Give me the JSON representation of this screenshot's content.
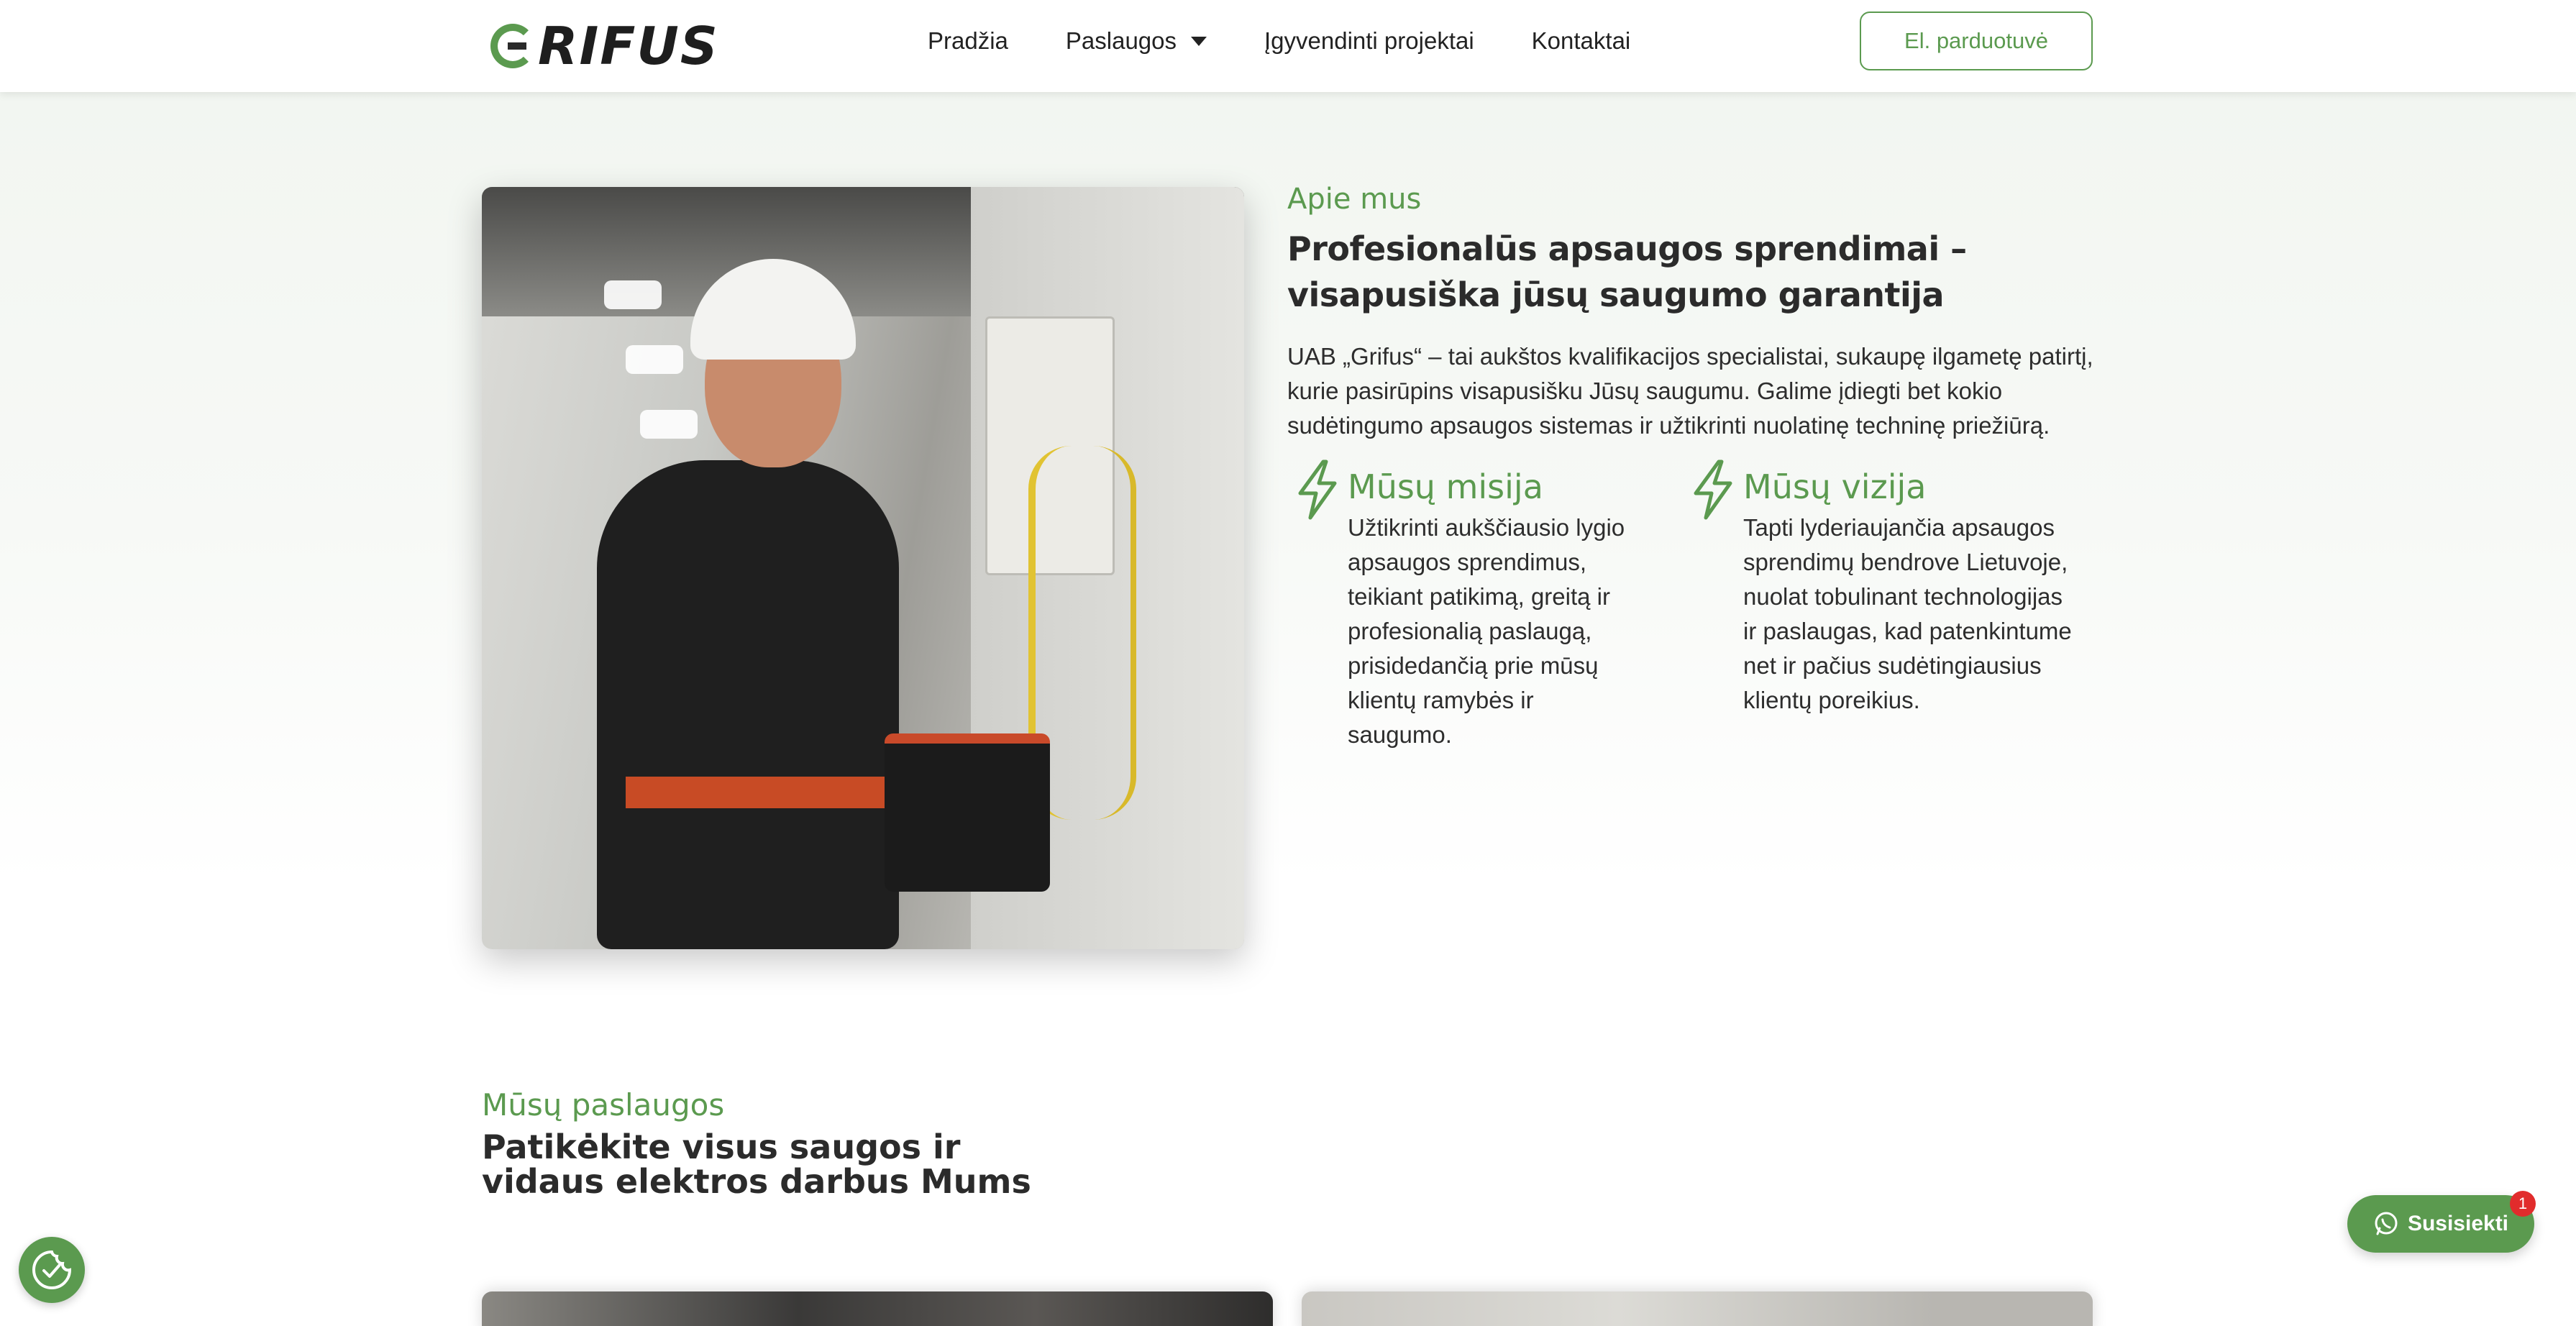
{
  "header": {
    "logo_text": "RIFUS",
    "nav": [
      {
        "label": "Pradžia"
      },
      {
        "label": "Paslaugos"
      },
      {
        "label": "Įgyvendinti projektai"
      },
      {
        "label": "Kontaktai"
      }
    ],
    "shop_button": "El. parduotuvė"
  },
  "about": {
    "eyebrow": "Apie mus",
    "title": "Profesionalūs apsaugos sprendimai – visapusiška jūsų saugumo garantija",
    "description": "UAB „Grifus“ – tai aukštos kvalifikacijos specialistai, sukaupę ilgametę patirtį, kurie pasirūpins visapusišku Jūsų saugumu. Galime įdiegti bet kokio sudėtingumo apsaugos sistemas ir užtikrinti nuolatinę techninę priežiūrą.",
    "mission": {
      "title": "Mūsų misija",
      "text": "Užtikrinti aukščiausio lygio apsaugos sprendimus, teikiant patikimą, greitą ir profesionalią paslaugą, prisidedančią prie mūsų klientų ramybės ir saugumo."
    },
    "vision": {
      "title": "Mūsų vizija",
      "text": "Tapti lyderiaujančia apsaugos sprendimų bendrove Lietuvoje, nuolat tobulinant technologijas ir paslaugas, kad patenkintume net ir pačius sudėtingiausius klientų poreikius."
    }
  },
  "services": {
    "eyebrow": "Mūsų paslaugos",
    "title_line1": "Patikėkite visus saugos ir",
    "title_line2": "vidaus elektros darbus Mums"
  },
  "whatsapp": {
    "label": "Susisiekti",
    "badge": "1"
  },
  "colors": {
    "accent": "#5b9a4f",
    "badge": "#e12c2c"
  }
}
